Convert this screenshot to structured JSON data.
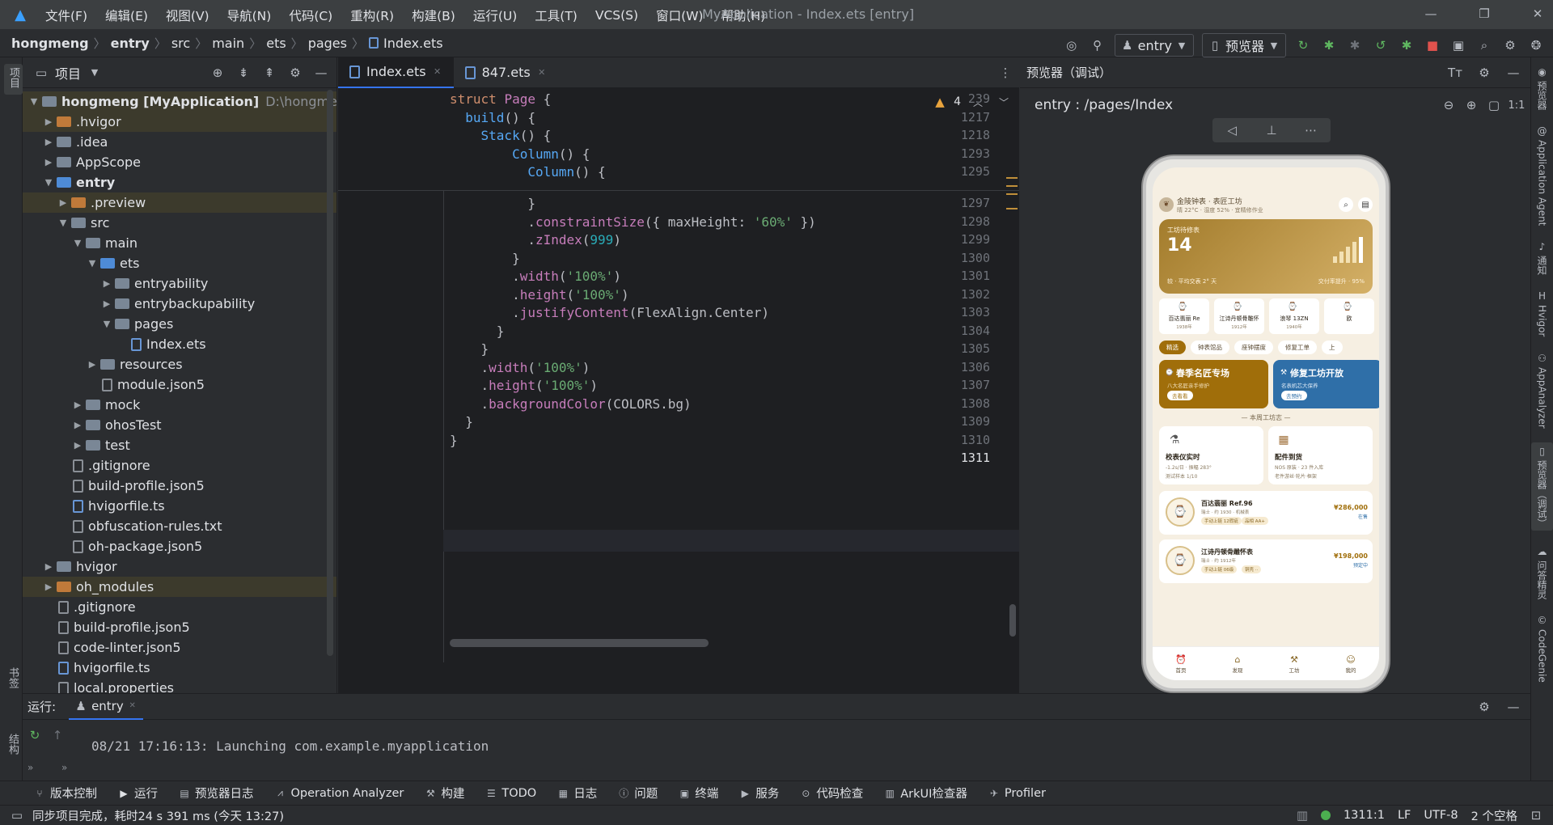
{
  "window": {
    "title": "MyApplication - Index.ets [entry]"
  },
  "menu": [
    "文件(F)",
    "编辑(E)",
    "视图(V)",
    "导航(N)",
    "代码(C)",
    "重构(R)",
    "构建(B)",
    "运行(U)",
    "工具(T)",
    "VCS(S)",
    "窗口(W)",
    "帮助(H)"
  ],
  "breadcrumb": [
    "hongmeng",
    "entry",
    "src",
    "main",
    "ets",
    "pages",
    "Index.ets"
  ],
  "toolbar": {
    "run_config": "entry",
    "device": "预览器"
  },
  "project": {
    "title": "项目",
    "tree": [
      {
        "label": "hongmeng [MyApplication]",
        "extra": "D:\\hongmeng",
        "depth": 0,
        "icon": "folder",
        "open": true
      },
      {
        "label": ".hvigor",
        "depth": 1,
        "icon": "folder-orange"
      },
      {
        "label": ".idea",
        "depth": 1,
        "icon": "folder"
      },
      {
        "label": "AppScope",
        "depth": 1,
        "icon": "folder"
      },
      {
        "label": "entry",
        "depth": 1,
        "icon": "folder-blue",
        "open": true
      },
      {
        "label": ".preview",
        "depth": 2,
        "icon": "folder-orange"
      },
      {
        "label": "src",
        "depth": 2,
        "icon": "folder",
        "open": true
      },
      {
        "label": "main",
        "depth": 3,
        "icon": "folder",
        "open": true
      },
      {
        "label": "ets",
        "depth": 4,
        "icon": "folder-blue",
        "open": true
      },
      {
        "label": "entryability",
        "depth": 5,
        "icon": "folder"
      },
      {
        "label": "entrybackupability",
        "depth": 5,
        "icon": "folder"
      },
      {
        "label": "pages",
        "depth": 5,
        "icon": "folder",
        "open": true
      },
      {
        "label": "Index.ets",
        "depth": 6,
        "icon": "file-ets"
      },
      {
        "label": "resources",
        "depth": 4,
        "icon": "folder"
      },
      {
        "label": "module.json5",
        "depth": 4,
        "icon": "file"
      },
      {
        "label": "mock",
        "depth": 3,
        "icon": "folder"
      },
      {
        "label": "ohosTest",
        "depth": 3,
        "icon": "folder"
      },
      {
        "label": "test",
        "depth": 3,
        "icon": "folder"
      },
      {
        "label": ".gitignore",
        "depth": 2,
        "icon": "file"
      },
      {
        "label": "build-profile.json5",
        "depth": 2,
        "icon": "file"
      },
      {
        "label": "hvigorfile.ts",
        "depth": 2,
        "icon": "file-ets"
      },
      {
        "label": "obfuscation-rules.txt",
        "depth": 2,
        "icon": "file"
      },
      {
        "label": "oh-package.json5",
        "depth": 2,
        "icon": "file"
      },
      {
        "label": "hvigor",
        "depth": 1,
        "icon": "folder"
      },
      {
        "label": "oh_modules",
        "depth": 1,
        "icon": "folder-orange"
      },
      {
        "label": ".gitignore",
        "depth": 1,
        "icon": "file"
      },
      {
        "label": "build-profile.json5",
        "depth": 1,
        "icon": "file"
      },
      {
        "label": "code-linter.json5",
        "depth": 1,
        "icon": "file"
      },
      {
        "label": "hvigorfile.ts",
        "depth": 1,
        "icon": "file-ets"
      },
      {
        "label": "local.properties",
        "depth": 1,
        "icon": "file"
      }
    ]
  },
  "editor": {
    "tabs": [
      {
        "label": "Index.ets",
        "active": true
      },
      {
        "label": "847.ets",
        "active": false
      }
    ],
    "warnings": "4",
    "sticky": [
      {
        "ln": "239",
        "code": "struct Page {"
      },
      {
        "ln": "1217",
        "code": "  build() {"
      },
      {
        "ln": "1218",
        "code": "    Stack() {"
      },
      {
        "ln": "1293",
        "code": "        Column() {"
      },
      {
        "ln": "1295",
        "code": "          Column() {"
      }
    ],
    "lines": [
      {
        "ln": "1297",
        "code": "          }"
      },
      {
        "ln": "1298",
        "code": "          .constraintSize({ maxHeight: '60%' })"
      },
      {
        "ln": "1299",
        "code": "          .zIndex(999)"
      },
      {
        "ln": "1300",
        "code": "        }"
      },
      {
        "ln": "1301",
        "code": "        .width('100%')"
      },
      {
        "ln": "1302",
        "code": "        .height('100%')"
      },
      {
        "ln": "1303",
        "code": "        .justifyContent(FlexAlign.Center)"
      },
      {
        "ln": "1304",
        "code": "      }"
      },
      {
        "ln": "1305",
        "code": "    }"
      },
      {
        "ln": "1306",
        "code": "    .width('100%')"
      },
      {
        "ln": "1307",
        "code": "    .height('100%')"
      },
      {
        "ln": "1308",
        "code": "    .backgroundColor(COLORS.bg)"
      },
      {
        "ln": "1309",
        "code": "  }"
      },
      {
        "ln": "1310",
        "code": "}"
      },
      {
        "ln": "1311",
        "code": ""
      }
    ]
  },
  "preview": {
    "title": "预览器（调试）",
    "route": "entry : /pages/Index",
    "app": {
      "header_title": "金陵钟表 · 表匠工坊",
      "header_sub": "晴 22°C · 湿度 52% · 宜精修作业",
      "card_label": "工坊待修表",
      "card_value": "14",
      "card_foot": "较 · 平均交表 2° 天",
      "card_right": "交付率提升 · 95%",
      "brands": [
        {
          "name": "百达翡丽 Re",
          "sub": "1938年"
        },
        {
          "name": "江诗丹顿骨雕怀",
          "sub": "1912年"
        },
        {
          "name": "浪琴 13ZN",
          "sub": "1940年"
        },
        {
          "name": "欧",
          "sub": ""
        }
      ],
      "chips": [
        "精选",
        "钟表馆品",
        "座钟摆度",
        "修复工单",
        "上"
      ],
      "banners": [
        {
          "title": "春季名匠专场",
          "sub": "八大名匠亲手修护",
          "btn": "去看看"
        },
        {
          "title": "修复工坊开放",
          "sub": "名表机芯大保养",
          "btn": "去预约"
        }
      ],
      "section": "— 本周工坊志 —",
      "tools": [
        {
          "title": "校表仪实时",
          "sub1": "-1.2s/日 · 振幅 283°",
          "sub2": "测试样本 1/10"
        },
        {
          "title": "配件到货",
          "sub1": "NOS 原装 · 23 件入库",
          "sub2": "老件游丝·轮片·框架"
        }
      ],
      "items": [
        {
          "title": "百达翡丽 Ref.96",
          "sub": "瑞士 · 约 1930 · 机械表",
          "tags": [
            "手动上链 12瑕疵",
            "品相 AA+"
          ],
          "price": "¥286,000",
          "state": "在售"
        },
        {
          "title": "江诗丹顿骨雕怀表",
          "sub": "瑞士 · 约 1912年",
          "tags": [
            "手动上链 06级",
            "铜壳 ··"
          ],
          "price": "¥198,000",
          "state": "预定中"
        }
      ],
      "tabs": [
        "首页",
        "发现",
        "工坊",
        "我的"
      ]
    }
  },
  "run": {
    "label": "运行:",
    "config": "entry",
    "console": "08/21 17:16:13: Launching com.example.myapplication"
  },
  "bottom_tools": [
    "版本控制",
    "运行",
    "预览器日志",
    "Operation Analyzer",
    "构建",
    "TODO",
    "日志",
    "问题",
    "终端",
    "服务",
    "代码检查",
    "ArkUI检查器",
    "Profiler"
  ],
  "status": {
    "message": "同步项目完成，耗时24 s 391 ms (今天 13:27)",
    "position": "1311:1",
    "eol": "LF",
    "encoding": "UTF-8",
    "indent": "2 个空格"
  },
  "left_strip": [
    "项目",
    "书签",
    "结构"
  ],
  "right_strip": [
    "预览器",
    "Application Agent",
    "通知",
    "Hvigor",
    "AppAnalyzer",
    "预览器（调试）",
    "问答精灵",
    "CodeGenie"
  ]
}
